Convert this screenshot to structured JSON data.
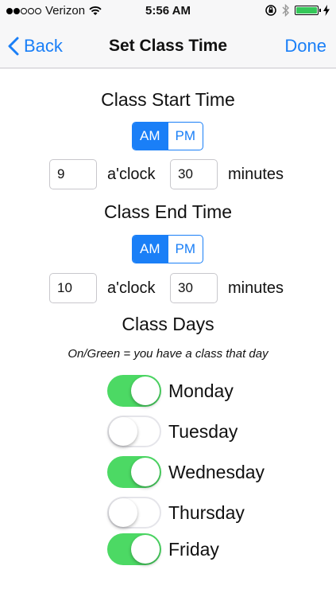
{
  "status": {
    "carrier": "Verizon",
    "time": "5:56 AM"
  },
  "nav": {
    "back_label": "Back",
    "title": "Set Class Time",
    "done_label": "Done"
  },
  "start": {
    "title": "Class Start Time",
    "am_label": "AM",
    "pm_label": "PM",
    "selected": "AM",
    "hour": "9",
    "hour_label": "a'clock",
    "minutes": "30",
    "minutes_label": "minutes"
  },
  "end": {
    "title": "Class End Time",
    "am_label": "AM",
    "pm_label": "PM",
    "selected": "AM",
    "hour": "10",
    "hour_label": "a'clock",
    "minutes": "30",
    "minutes_label": "minutes"
  },
  "days": {
    "title": "Class Days",
    "hint": "On/Green = you have a class that day",
    "items": [
      {
        "label": "Monday",
        "on": true
      },
      {
        "label": "Tuesday",
        "on": false
      },
      {
        "label": "Wednesday",
        "on": true
      },
      {
        "label": "Thursday",
        "on": false
      },
      {
        "label": "Friday",
        "on": true
      }
    ]
  },
  "colors": {
    "accent": "#1a7ff7",
    "switch_on": "#4cd964"
  }
}
